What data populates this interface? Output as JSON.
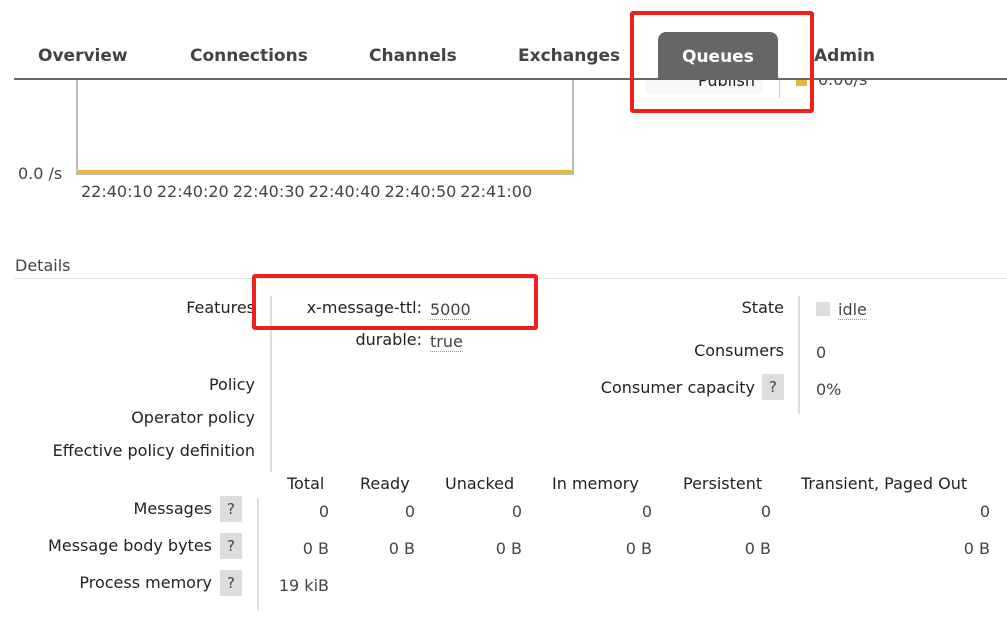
{
  "nav": {
    "tabs": [
      "Overview",
      "Connections",
      "Channels",
      "Exchanges",
      "Queues",
      "Admin"
    ],
    "active": "Queues"
  },
  "chart_data": {
    "type": "line",
    "x_ticks": [
      "22:40:10",
      "22:40:20",
      "22:40:30",
      "22:40:40",
      "22:40:50",
      "22:41:00"
    ],
    "y_ticks": [
      "0.0 /s"
    ],
    "series": [
      {
        "name": "Publish",
        "values": [
          0,
          0,
          0,
          0,
          0,
          0
        ],
        "color": "#e8b83a"
      }
    ],
    "legend": {
      "label": "Publish",
      "value": "0.00/s"
    }
  },
  "details": {
    "heading": "Details",
    "features_label": "Features",
    "features": [
      {
        "key": "x-message-ttl:",
        "value": "5000"
      },
      {
        "key": "durable:",
        "value": "true"
      }
    ],
    "policy_label": "Policy",
    "operator_policy_label": "Operator policy",
    "effective_policy_label": "Effective policy definition",
    "state_label": "State",
    "state_value": "idle",
    "consumers_label": "Consumers",
    "consumers_value": "0",
    "capacity_label": "Consumer capacity",
    "capacity_value": "0%",
    "help": "?"
  },
  "stats": {
    "columns": [
      "Total",
      "Ready",
      "Unacked",
      "In memory",
      "Persistent",
      "Transient, Paged Out"
    ],
    "rows": [
      {
        "label": "Messages",
        "values": [
          "0",
          "0",
          "0",
          "0",
          "0",
          "0"
        ]
      },
      {
        "label": "Message body bytes",
        "values": [
          "0 B",
          "0 B",
          "0 B",
          "0 B",
          "0 B",
          "0 B"
        ]
      },
      {
        "label": "Process memory",
        "values": [
          "19 kiB"
        ]
      }
    ]
  },
  "colors": {
    "highlight": "#f0201a",
    "active_tab": "#666666",
    "series": "#e8b83a"
  }
}
